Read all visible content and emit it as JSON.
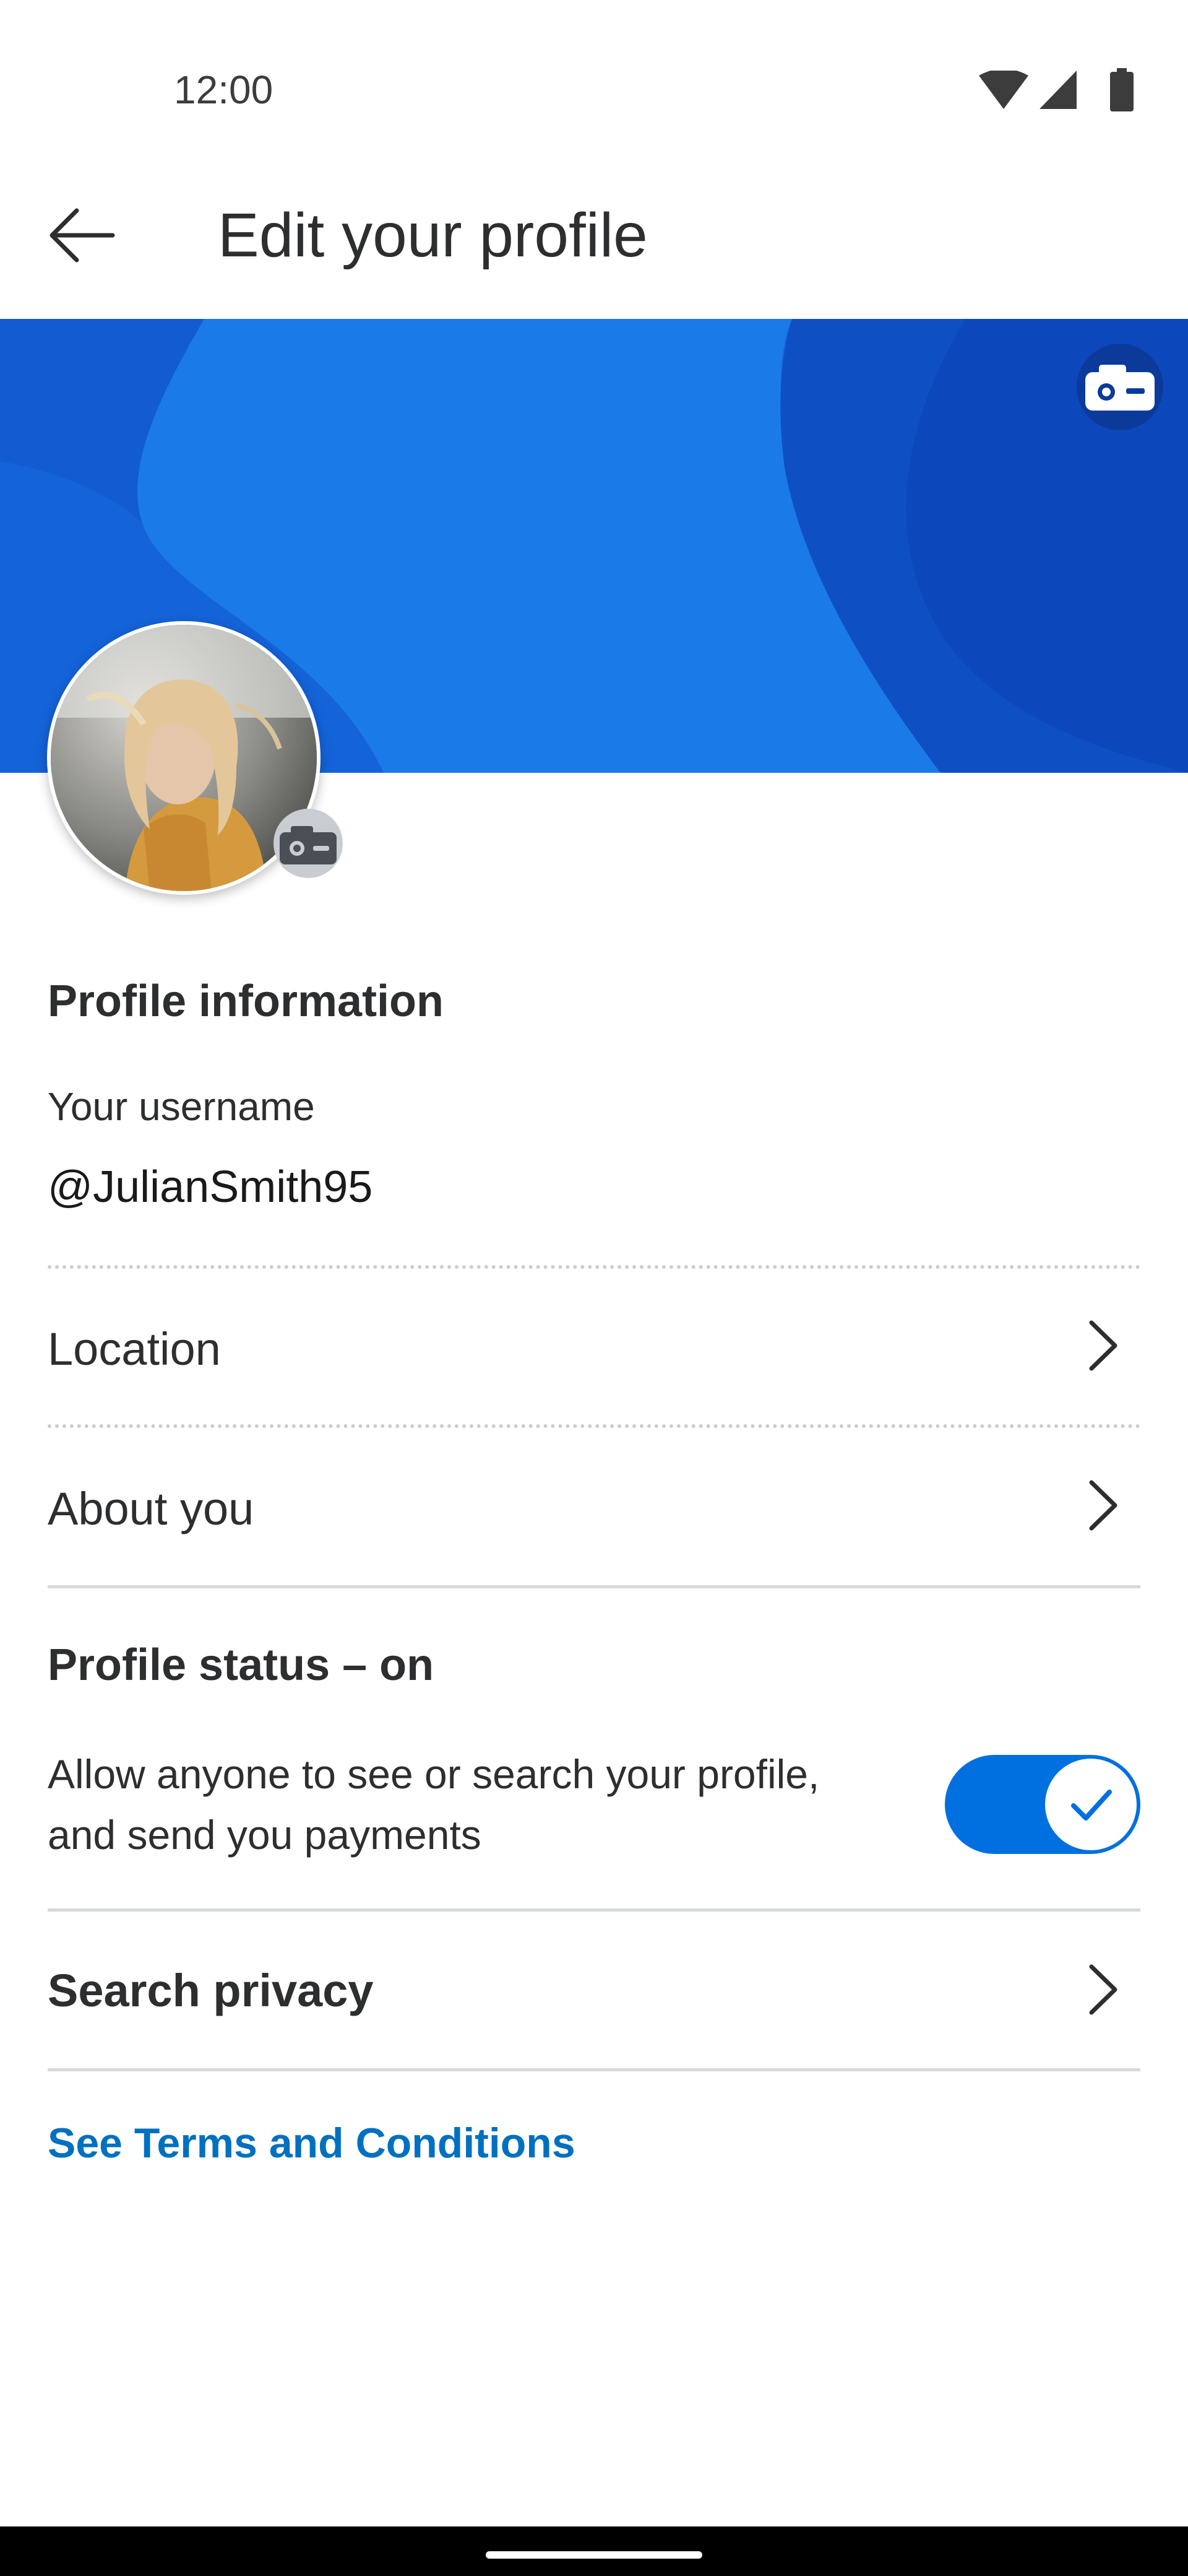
{
  "status_bar": {
    "time": "12:00",
    "icons": [
      "wifi-icon",
      "signal-icon",
      "battery-icon"
    ]
  },
  "app_bar": {
    "back_icon": "arrow-left-icon",
    "title": "Edit your profile"
  },
  "banner": {
    "camera_icon": "camera-icon",
    "colors": {
      "base": "#1463d8",
      "light": "#1a7ae8",
      "dark": "#0f4fc4"
    }
  },
  "avatar": {
    "camera_icon": "camera-icon"
  },
  "profile_info": {
    "heading": "Profile information",
    "username_label": "Your username",
    "username_value": "@JulianSmith95",
    "location_label": "Location",
    "about_label": "About you"
  },
  "profile_status": {
    "heading": "Profile status – on",
    "description_line1": "Allow anyone to see or search your profile,",
    "description_line2": "and send you payments",
    "toggle_on": true
  },
  "search_privacy": {
    "label": "Search privacy"
  },
  "terms": {
    "link": "See Terms and Conditions"
  },
  "colors": {
    "accent": "#0070e0",
    "link": "#0070c0",
    "text": "#2c2e2f"
  }
}
